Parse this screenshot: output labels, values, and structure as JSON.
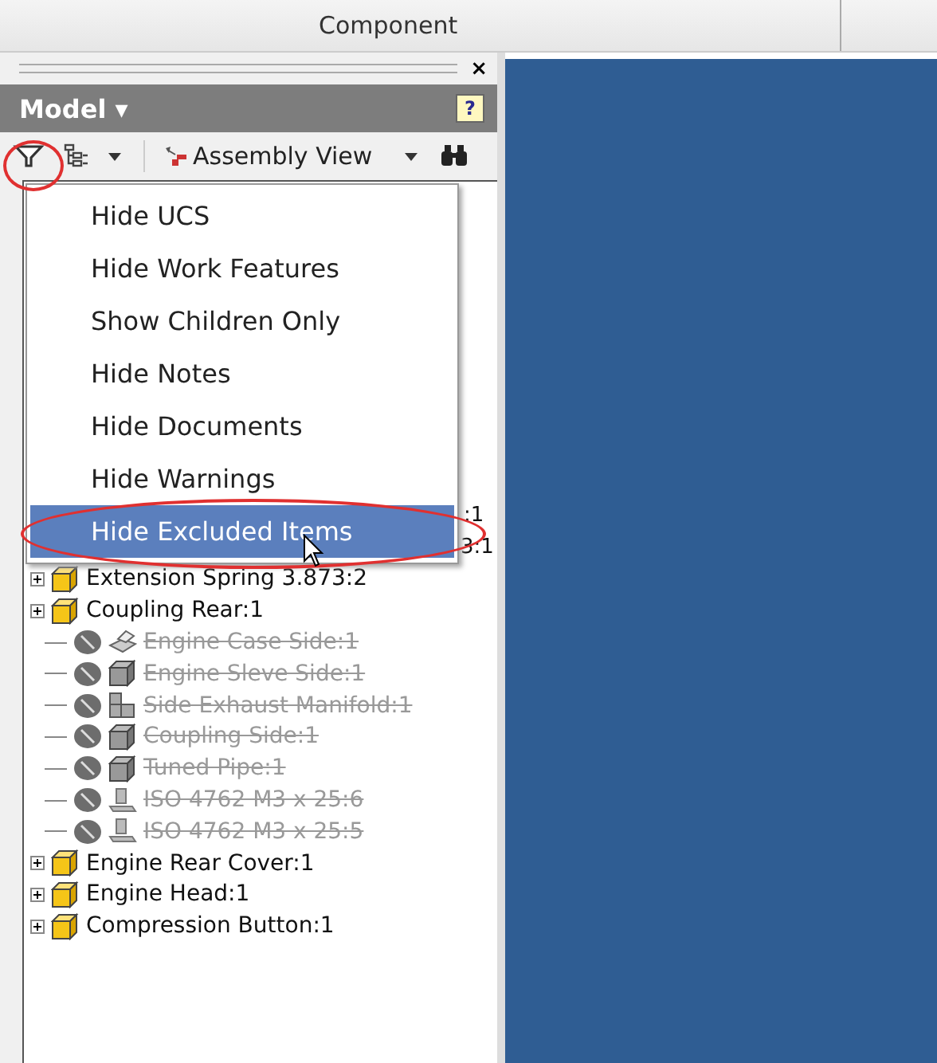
{
  "header": {
    "title": "Component"
  },
  "panel": {
    "title": "Model ▾",
    "close": "×",
    "help": "?"
  },
  "toolbar": {
    "view_label": "Assembly View"
  },
  "filter_menu": {
    "items": [
      {
        "label": "Hide UCS",
        "selected": false
      },
      {
        "label": "Hide Work Features",
        "selected": false
      },
      {
        "label": "Show Children Only",
        "selected": false
      },
      {
        "label": "Hide Notes",
        "selected": false
      },
      {
        "label": "Hide Documents",
        "selected": false
      },
      {
        "label": "Hide Warnings",
        "selected": false
      },
      {
        "label": "Hide Excluded Items",
        "selected": true
      }
    ]
  },
  "tree": {
    "partial_rows": [
      ":1",
      "3:1"
    ],
    "items": [
      {
        "label": "Extension Spring 3.873:2",
        "kind": "part",
        "excluded": false
      },
      {
        "label": "Coupling Rear:1",
        "kind": "part",
        "excluded": false,
        "children": [
          {
            "label": "Engine Case Side:1",
            "kind": "sheet",
            "excluded": true
          },
          {
            "label": "Engine Sleve Side:1",
            "kind": "part",
            "excluded": true
          },
          {
            "label": "Side Exhaust Manifold:1",
            "kind": "assembly",
            "excluded": true
          },
          {
            "label": "Coupling Side:1",
            "kind": "part",
            "excluded": true
          },
          {
            "label": "Tuned Pipe:1",
            "kind": "part",
            "excluded": true
          },
          {
            "label": "ISO 4762 M3 x 25:6",
            "kind": "fastener",
            "excluded": true
          },
          {
            "label": "ISO 4762 M3 x 25:5",
            "kind": "fastener",
            "excluded": true
          }
        ]
      },
      {
        "label": "Engine Rear Cover:1",
        "kind": "part",
        "excluded": false
      },
      {
        "label": "Engine Head:1",
        "kind": "part",
        "excluded": false
      },
      {
        "label": "Compression Button:1",
        "kind": "part",
        "excluded": false
      }
    ]
  }
}
